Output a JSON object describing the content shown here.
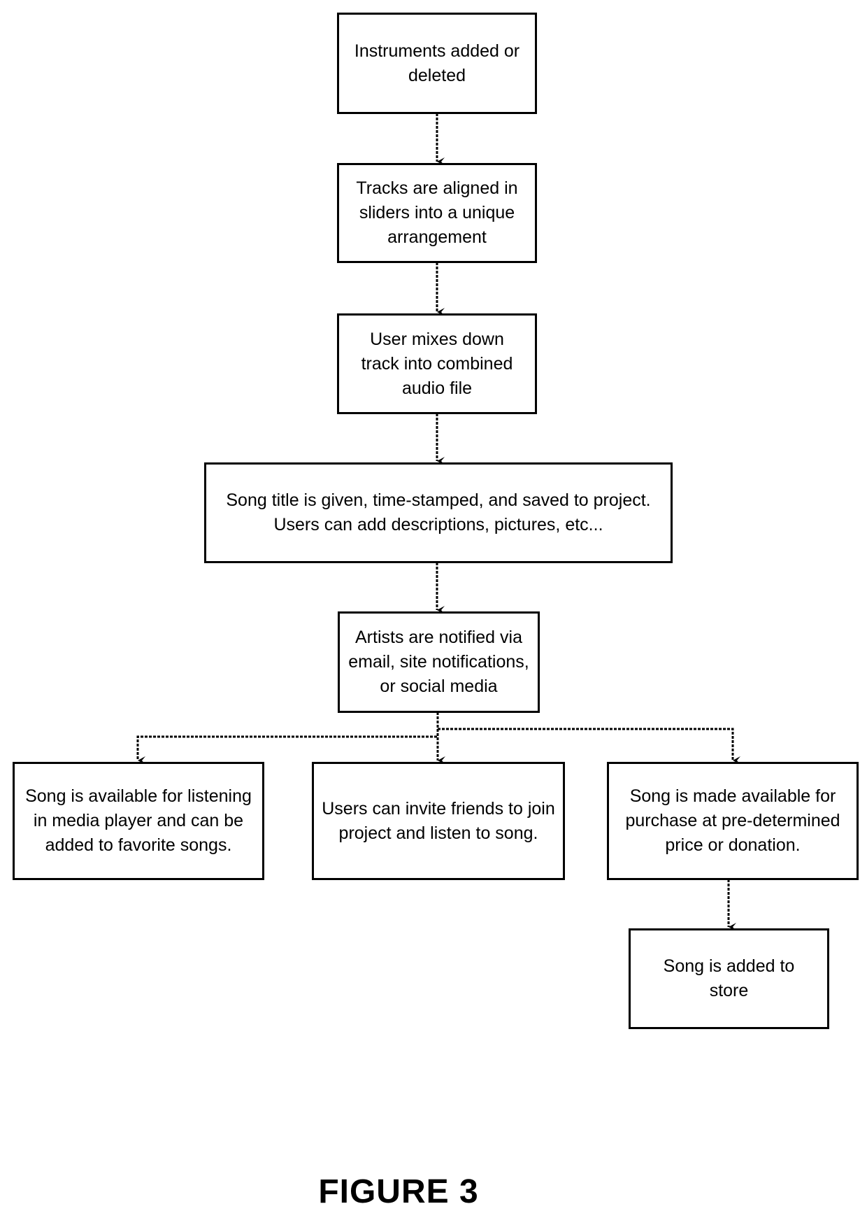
{
  "diagram": {
    "type": "flowchart",
    "nodes": [
      {
        "id": "instruments",
        "text": "Instruments added or deleted"
      },
      {
        "id": "tracks",
        "text": "Tracks are aligned in sliders into a unique arrangement"
      },
      {
        "id": "mixdown",
        "text": "User mixes down track into combined audio file"
      },
      {
        "id": "title",
        "text": "Song title is given, time-stamped, and saved to project.  Users can add descriptions, pictures, etc..."
      },
      {
        "id": "notify",
        "text": "Artists are notified via email, site notifications, or social media"
      },
      {
        "id": "listen",
        "text": "Song is available for listening in media player and can be added to favorite songs."
      },
      {
        "id": "invite",
        "text": "Users can invite friends to join project and listen to song."
      },
      {
        "id": "purchase",
        "text": "Song is made available for purchase at pre-determined price or donation."
      },
      {
        "id": "store",
        "text": "Song is added to store"
      }
    ],
    "edges": [
      {
        "from": "instruments",
        "to": "tracks"
      },
      {
        "from": "tracks",
        "to": "mixdown"
      },
      {
        "from": "mixdown",
        "to": "title"
      },
      {
        "from": "title",
        "to": "notify"
      },
      {
        "from": "notify",
        "to": "listen"
      },
      {
        "from": "notify",
        "to": "invite"
      },
      {
        "from": "notify",
        "to": "purchase"
      },
      {
        "from": "purchase",
        "to": "store"
      }
    ],
    "edge_style": "dashed",
    "line_color": "#000000",
    "background": "#ffffff"
  },
  "figure_label": "FIGURE 3"
}
